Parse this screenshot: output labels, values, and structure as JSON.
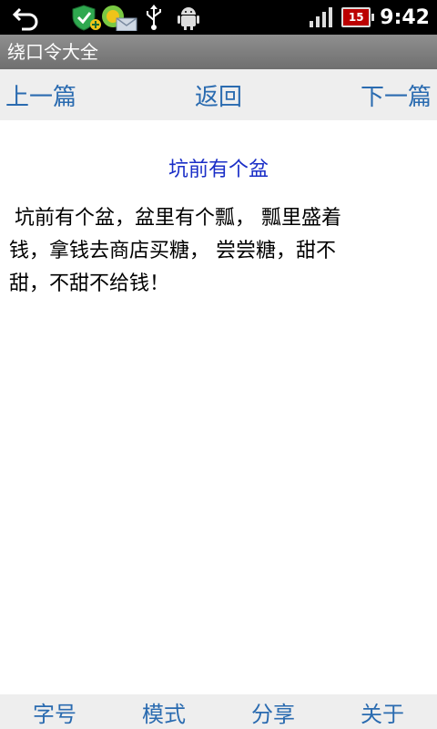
{
  "status_bar": {
    "time": "9:42",
    "battery_level": "15",
    "icons": [
      "back-icon",
      "shield-add-icon",
      "message-icon",
      "usb-icon",
      "android-debug-icon",
      "signal-icon",
      "battery-icon"
    ]
  },
  "app": {
    "title": "绕口令大全"
  },
  "nav": {
    "prev": "上一篇",
    "back": "返回",
    "next": "下一篇"
  },
  "article": {
    "title": "坑前有个盆",
    "body": "坑前有个盆，盆里有个瓢， 瓢里盛着钱，拿钱去商店买糖， 尝尝糖，甜不甜，不甜不给钱！"
  },
  "bottom_tabs": [
    "字号",
    "模式",
    "分享",
    "关于"
  ],
  "colors": {
    "link": "#2a6bb0",
    "title": "#1a2ec7",
    "status_bar_bg": "#000000",
    "title_bar_bg": "#7f7f7f",
    "nav_bg": "#eeeeee",
    "battery": "#bb0000"
  }
}
